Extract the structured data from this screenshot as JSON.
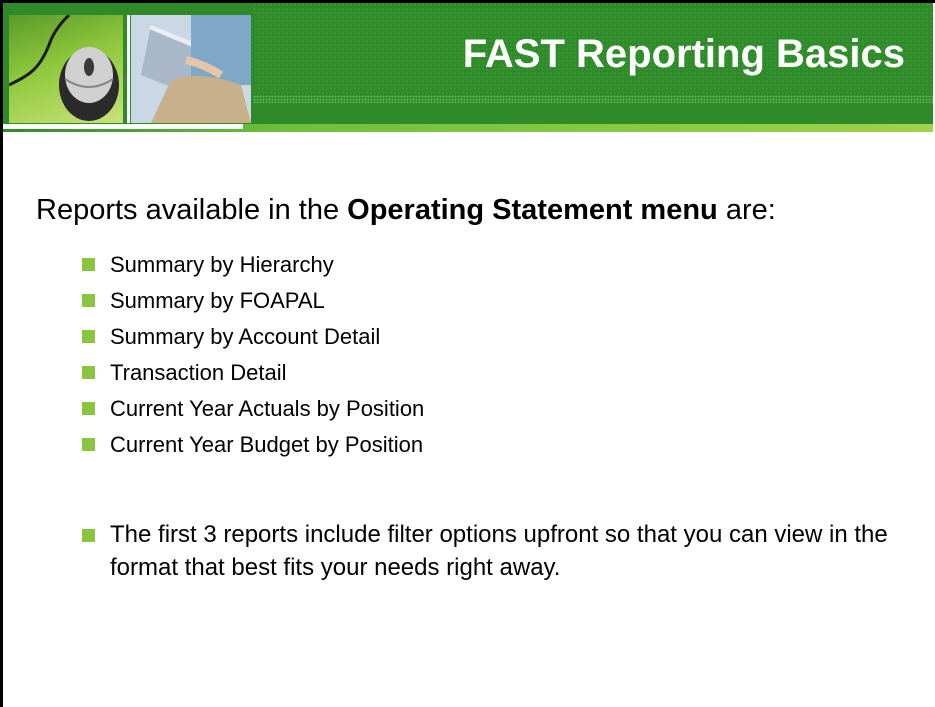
{
  "slide": {
    "title": "FAST Reporting Basics",
    "intro": {
      "prefix": "Reports available in the ",
      "emphasis": "Operating Statement menu",
      "suffix": " are:"
    },
    "bullets": [
      "Summary by Hierarchy",
      "Summary by FOAPAL",
      "Summary by Account Detail",
      "Transaction Detail",
      "Current Year Actuals by Position",
      "Current Year Budget by Position"
    ],
    "note": "The first 3 reports include filter options upfront so that you can view in the format that best fits your needs right away."
  },
  "colors": {
    "header_green": "#2f8a2a",
    "bullet_green": "#8ac53f",
    "text": "#000000",
    "title_text": "#ffffff"
  },
  "icons": {
    "bullet": "square-bullet-icon"
  }
}
